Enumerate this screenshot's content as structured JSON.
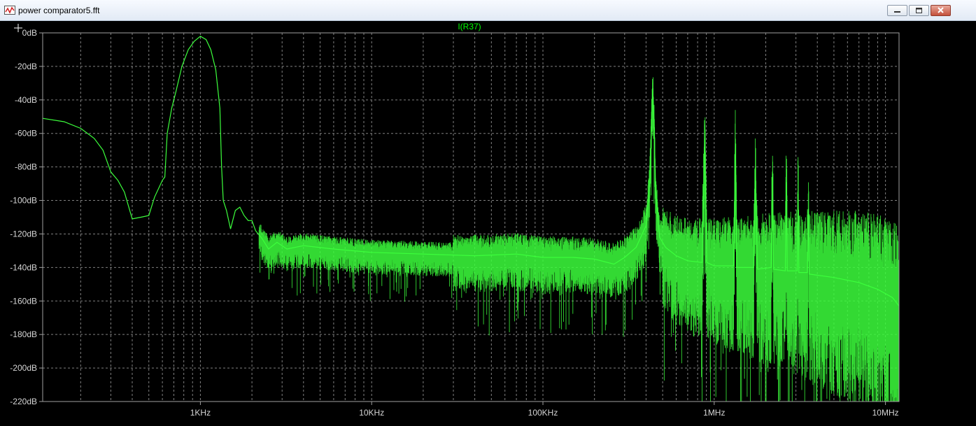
{
  "window": {
    "title": "power comparator5.fft",
    "icon": "waveform-icon",
    "controls": [
      "minimize-icon",
      "restore-icon",
      "close-icon"
    ]
  },
  "colors": {
    "background": "#000000",
    "trace": "#3cff3c",
    "grid": "#808080",
    "axis_text": "#d6d6d6",
    "title": "#00ff00"
  },
  "chart_data": {
    "type": "line",
    "title": "I(R37)",
    "x_scale": "log",
    "y_unit": "dB",
    "xlim": [
      120,
      12000000
    ],
    "ylim": [
      -220,
      0
    ],
    "grid": true,
    "x_ticks": [
      {
        "value": 1000,
        "label": "1KHz"
      },
      {
        "value": 10000,
        "label": "10KHz"
      },
      {
        "value": 100000,
        "label": "100KHz"
      },
      {
        "value": 1000000,
        "label": "1MHz"
      },
      {
        "value": 10000000,
        "label": "10MHz"
      }
    ],
    "y_ticks": [
      {
        "value": 0,
        "label": "0dB"
      },
      {
        "value": -20,
        "label": "-20dB"
      },
      {
        "value": -40,
        "label": "-40dB"
      },
      {
        "value": -60,
        "label": "-60dB"
      },
      {
        "value": -80,
        "label": "-80dB"
      },
      {
        "value": -100,
        "label": "-100dB"
      },
      {
        "value": -120,
        "label": "-120dB"
      },
      {
        "value": -140,
        "label": "-140dB"
      },
      {
        "value": -160,
        "label": "-160dB"
      },
      {
        "value": -180,
        "label": "-180dB"
      },
      {
        "value": -200,
        "label": "-200dB"
      },
      {
        "value": -220,
        "label": "-220dB"
      }
    ],
    "series": [
      {
        "points": [
          [
            120,
            -51
          ],
          [
            160,
            -53
          ],
          [
            200,
            -57
          ],
          [
            240,
            -63
          ],
          [
            270,
            -70
          ],
          [
            300,
            -83
          ],
          [
            330,
            -88
          ],
          [
            360,
            -95
          ],
          [
            400,
            -111
          ],
          [
            450,
            -110
          ],
          [
            500,
            -109
          ],
          [
            540,
            -98
          ],
          [
            600,
            -88
          ],
          [
            620,
            -86
          ],
          [
            640,
            -60
          ],
          [
            680,
            -45
          ],
          [
            720,
            -35
          ],
          [
            780,
            -20
          ],
          [
            850,
            -10
          ],
          [
            920,
            -5
          ],
          [
            1000,
            -2
          ],
          [
            1080,
            -4
          ],
          [
            1150,
            -10
          ],
          [
            1230,
            -22
          ],
          [
            1300,
            -45
          ],
          [
            1330,
            -80
          ],
          [
            1360,
            -100
          ],
          [
            1420,
            -106
          ],
          [
            1500,
            -117
          ],
          [
            1600,
            -106
          ],
          [
            1700,
            -104
          ],
          [
            1800,
            -109
          ],
          [
            1900,
            -112
          ],
          [
            2000,
            -112
          ],
          [
            2100,
            -118
          ],
          [
            2300,
            -123
          ],
          [
            2500,
            -129
          ],
          [
            2800,
            -125
          ],
          [
            3200,
            -129
          ],
          [
            4000,
            -127
          ],
          [
            6000,
            -129
          ],
          [
            10000,
            -131
          ],
          [
            20000,
            -132
          ],
          [
            40000,
            -133
          ],
          [
            70000,
            -132
          ],
          [
            100000,
            -134
          ],
          [
            150000,
            -134
          ],
          [
            200000,
            -135
          ],
          [
            260000,
            -138
          ],
          [
            300000,
            -134
          ],
          [
            350000,
            -128
          ],
          [
            400000,
            -115
          ],
          [
            420000,
            -90
          ],
          [
            430000,
            -55
          ],
          [
            438000,
            -33
          ],
          [
            446000,
            -55
          ],
          [
            455000,
            -95
          ],
          [
            480000,
            -122
          ],
          [
            520000,
            -128
          ],
          [
            600000,
            -133
          ],
          [
            700000,
            -136
          ],
          [
            850000,
            -137
          ],
          [
            870000,
            -90
          ],
          [
            880000,
            -63
          ],
          [
            890000,
            -90
          ],
          [
            905000,
            -137
          ],
          [
            1000000,
            -139
          ],
          [
            1300000,
            -139
          ],
          [
            1320000,
            -90
          ],
          [
            1330000,
            -66
          ],
          [
            1340000,
            -90
          ],
          [
            1355000,
            -140
          ],
          [
            1700000,
            -140
          ],
          [
            1740000,
            -80
          ],
          [
            1760000,
            -110
          ],
          [
            1790000,
            -141
          ],
          [
            2150000,
            -140
          ],
          [
            2190000,
            -84
          ],
          [
            2220000,
            -141
          ],
          [
            2600000,
            -142
          ],
          [
            2640000,
            -89
          ],
          [
            2670000,
            -142
          ],
          [
            3050000,
            -142
          ],
          [
            3090000,
            -96
          ],
          [
            3120000,
            -143
          ],
          [
            3500000,
            -143
          ],
          [
            3550000,
            -105
          ],
          [
            3590000,
            -144
          ],
          [
            5000000,
            -146
          ],
          [
            7000000,
            -149
          ],
          [
            9000000,
            -153
          ],
          [
            11000000,
            -158
          ],
          [
            12000000,
            -163
          ]
        ]
      }
    ]
  }
}
